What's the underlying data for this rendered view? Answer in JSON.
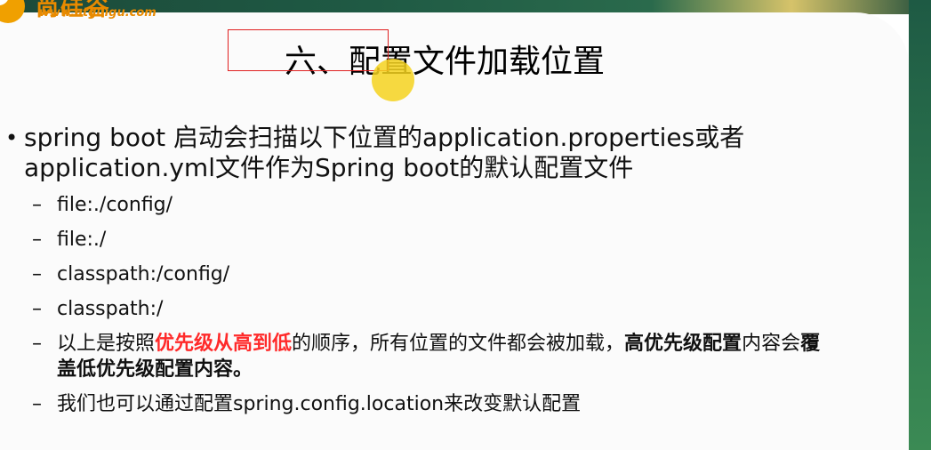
{
  "logo": {
    "brand": "尚硅谷",
    "url": "www.atguigu.com"
  },
  "slide": {
    "title": "六、配置文件加载位置",
    "bullet": "spring boot 启动会扫描以下位置的application.properties或者application.yml文件作为Spring boot的默认配置文件",
    "items": [
      "file:./config/",
      "file:./",
      "classpath:/config/",
      "classpath:/"
    ],
    "priority": {
      "p1": "以上是按照",
      "p2": "优先级从高到低",
      "p3": "的顺序，所有位置的文件都会被加载，",
      "p4": "高优先级配置",
      "p5": "内容会",
      "p6": "覆盖低优先级配置",
      "p7": "内容。"
    },
    "last_item": "我们也可以通过配置spring.config.location来改变默认配置"
  },
  "colors": {
    "highlight_red": "#ff2a2a",
    "annotation_box": "#e02020",
    "cursor": "#f5d21e"
  }
}
